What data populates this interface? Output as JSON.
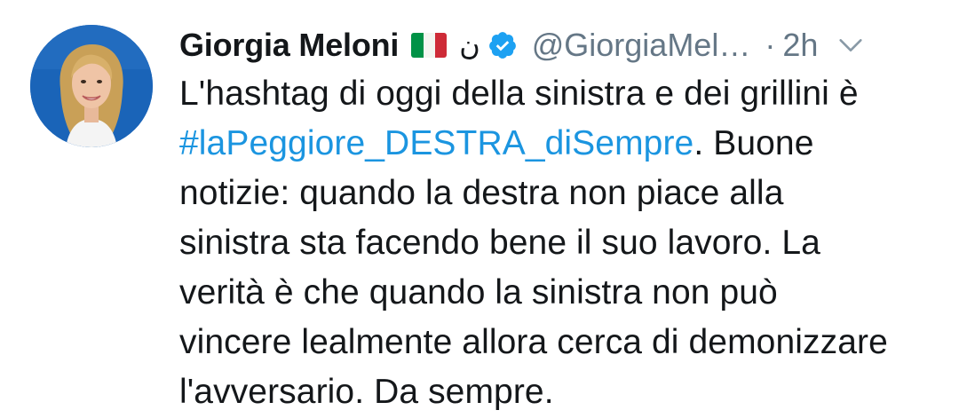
{
  "tweet": {
    "author": {
      "name": "Giorgia Meloni",
      "emoji_flag": "italy-flag",
      "symbol": "ن",
      "verified": true,
      "handle": "@GiorgiaMel…",
      "separator": "·",
      "time": "2h"
    },
    "text": {
      "line1": "L'hashtag di oggi della sinistra e dei grillini è",
      "hashtag": "#laPeggiore_DESTRA_diSempre",
      "line2_rest": ". Buone",
      "line3": "notizie: quando la destra non piace alla",
      "line4": "sinistra sta facendo bene il suo lavoro. La",
      "line5": "verità è che quando la sinistra non può",
      "line6": "vincere lealmente allora cerca di demonizzare",
      "line7": "l'avversario. Da sempre."
    }
  },
  "colors": {
    "hashtag": "#1b95e0",
    "verified": "#1da1f2",
    "muted": "#657786",
    "text": "#14171a",
    "flag_green": "#009246",
    "flag_white": "#ffffff",
    "flag_red": "#ce2b37"
  },
  "icons": {
    "verified": "verified-badge-icon",
    "more": "chevron-down-icon"
  }
}
